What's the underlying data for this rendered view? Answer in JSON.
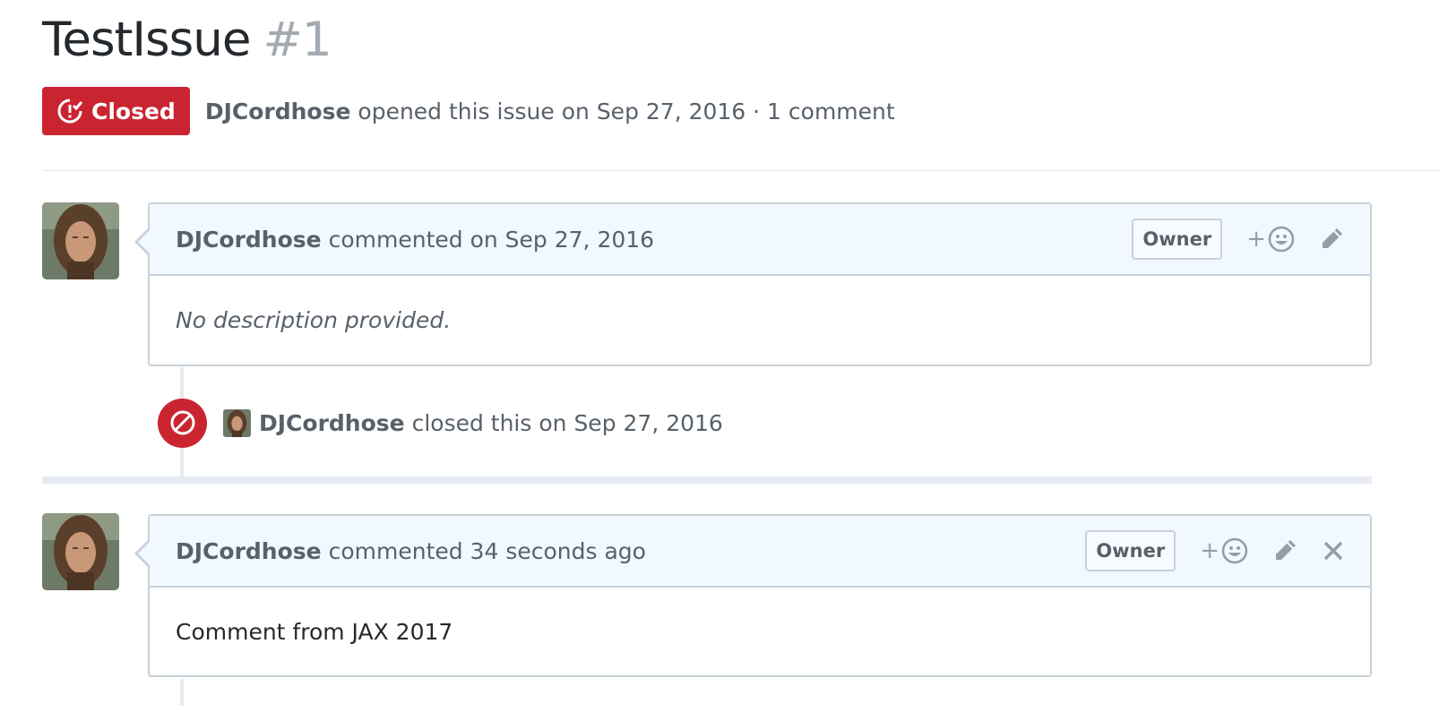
{
  "issue": {
    "title": "TestIssue",
    "number": "#1",
    "state_label": "Closed",
    "author": "DJCordhose",
    "opened_text": "opened this issue on Sep 27, 2016 · 1 comment"
  },
  "comments": [
    {
      "author": "DJCordhose",
      "action_text": "commented on Sep 27, 2016",
      "role_badge": "Owner",
      "reaction_label": "+",
      "body": "No description provided."
    },
    {
      "author": "DJCordhose",
      "action_text": "commented 34 seconds ago",
      "role_badge": "Owner",
      "reaction_label": "+",
      "body": "Comment from JAX 2017"
    }
  ],
  "events": [
    {
      "author": "DJCordhose",
      "text": "closed this on Sep 27, 2016"
    }
  ],
  "icons": {
    "state_icon": "issue-closed-icon",
    "event_icon": "circle-slash-icon",
    "reaction_icon": "smiley-icon",
    "edit_icon": "pencil-icon",
    "delete_icon": "x-icon"
  },
  "colors": {
    "closed_red": "#cb2431",
    "header_blue": "#f1f8ff",
    "border": "#c8d1d9",
    "muted_text": "#586069"
  }
}
